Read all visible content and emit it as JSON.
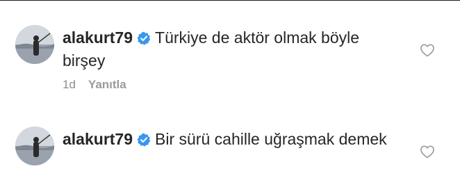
{
  "comments": [
    {
      "username": "alakurt79",
      "verified": true,
      "text": "Türkiye de aktör olmak böyle birşey",
      "time": "1d",
      "reply_label": "Yanıtla"
    },
    {
      "username": "alakurt79",
      "verified": true,
      "text": "Bir sürü cahille uğraşmak demek"
    }
  ],
  "icons": {
    "verified": "verified-badge-icon",
    "like": "heart-outline-icon"
  },
  "colors": {
    "text": "#262626",
    "meta": "#8e8e8e",
    "verified_badge": "#3897f0"
  }
}
